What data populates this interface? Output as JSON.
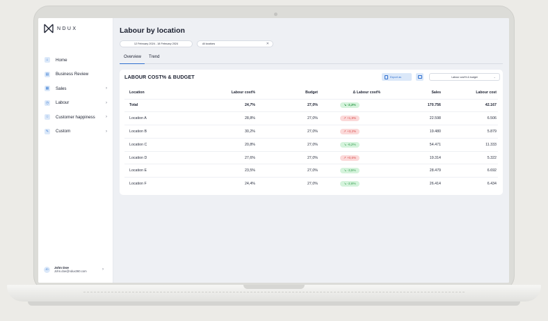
{
  "app": {
    "logo_text": "NDUX"
  },
  "sidebar": {
    "items": [
      {
        "label": "Home",
        "icon": "home-icon",
        "chevron": false
      },
      {
        "label": "Business Review",
        "icon": "report-icon",
        "chevron": false
      },
      {
        "label": "Sales",
        "icon": "sales-icon",
        "chevron": true
      },
      {
        "label": "Labour",
        "icon": "clock-icon",
        "chevron": true
      },
      {
        "label": "Customer happiness",
        "icon": "star-icon",
        "chevron": true
      },
      {
        "label": "Custom",
        "icon": "custom-icon",
        "chevron": true
      }
    ],
    "user": {
      "name": "John Doe",
      "email": "John.doe@ndux360.com",
      "initials": "JD"
    }
  },
  "header": {
    "title": "Labour by location",
    "date_range": "12 February 2024 - 18 February 2024",
    "location_filter": "All locations"
  },
  "tabs": [
    {
      "label": "Overview",
      "active": true
    },
    {
      "label": "Trend",
      "active": false
    }
  ],
  "card": {
    "title": "LABOUR COST% & BUDGET",
    "export_label": "Export as",
    "select_value": "Labour cost% & budget"
  },
  "table": {
    "headers": [
      "Location",
      "Labour cost%",
      "Budget",
      "Δ Labour cost%",
      "Sales",
      "Labour cost"
    ],
    "rows": [
      {
        "location": "Total",
        "labour_pct": "24,7%",
        "budget": "27,0%",
        "delta": "-2,3%",
        "trend": "down",
        "sales": "170.756",
        "labour_cost": "42.167",
        "total": true
      },
      {
        "location": "Location A",
        "labour_pct": "28,8%",
        "budget": "27,0%",
        "delta": "+1,8%",
        "trend": "up",
        "sales": "22.598",
        "labour_cost": "6.506"
      },
      {
        "location": "Location B",
        "labour_pct": "30,2%",
        "budget": "27,0%",
        "delta": "+3,2%",
        "trend": "up",
        "sales": "19.480",
        "labour_cost": "5.879"
      },
      {
        "location": "Location C",
        "labour_pct": "20,8%",
        "budget": "27,0%",
        "delta": "-6,2%",
        "trend": "down",
        "sales": "54.471",
        "labour_cost": "11.333"
      },
      {
        "location": "Location D",
        "labour_pct": "27,6%",
        "budget": "27,0%",
        "delta": "+0,6%",
        "trend": "up",
        "sales": "19.314",
        "labour_cost": "5.322"
      },
      {
        "location": "Location E",
        "labour_pct": "23,5%",
        "budget": "27,0%",
        "delta": "-3,5%",
        "trend": "down",
        "sales": "28.479",
        "labour_cost": "6.692"
      },
      {
        "location": "Location F",
        "labour_pct": "24,4%",
        "budget": "27,0%",
        "delta": "-2,6%",
        "trend": "down",
        "sales": "26.414",
        "labour_cost": "6.434"
      }
    ]
  },
  "colors": {
    "accent": "#2f6fcf",
    "positive": "#2f9a4a",
    "negative": "#d9504f"
  }
}
